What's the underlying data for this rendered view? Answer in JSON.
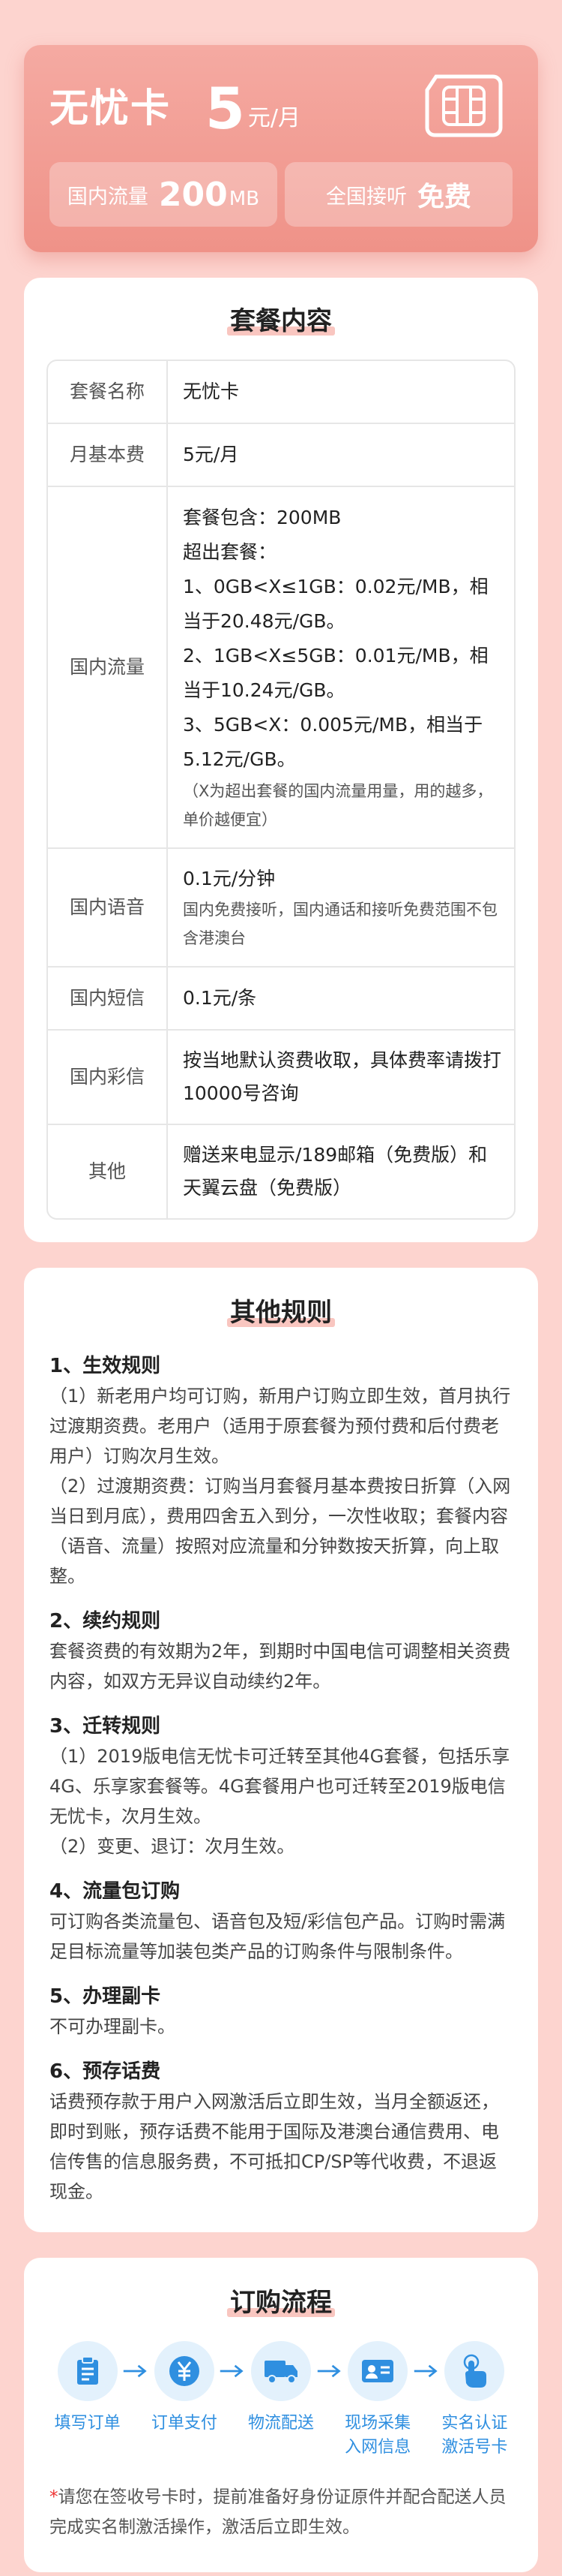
{
  "hero": {
    "name": "无忧卡",
    "price": "5",
    "price_unit": "元/月",
    "traffic_label": "国内流量",
    "traffic_value": "200",
    "traffic_unit": "MB",
    "call_label": "全国接听",
    "call_value": "免费"
  },
  "plan": {
    "title": "套餐内容",
    "rows": {
      "name": {
        "key": "套餐名称",
        "value": "无忧卡"
      },
      "fee": {
        "key": "月基本费",
        "value": "5元/月"
      },
      "traffic": {
        "key": "国内流量",
        "lines": [
          "套餐包含：200MB",
          "超出套餐：",
          "1、0GB<X≤1GB：0.02元/MB，相当于20.48元/GB。",
          "2、1GB<X≤5GB：0.01元/MB，相当于10.24元/GB。",
          "3、5GB<X：0.005元/MB，相当于5.12元/GB。"
        ],
        "note": "（X为超出套餐的国内流量用量，用的越多，单价越便宜）"
      },
      "voice": {
        "key": "国内语音",
        "value": "0.1元/分钟",
        "note": "国内免费接听，国内通话和接听免费范围不包含港澳台"
      },
      "sms": {
        "key": "国内短信",
        "value": "0.1元/条"
      },
      "mms": {
        "key": "国内彩信",
        "value": "按当地默认资费收取，具体费率请拨打10000号咨询"
      },
      "other": {
        "key": "其他",
        "value": "赠送来电显示/189邮箱（免费版）和天翼云盘（免费版）"
      }
    }
  },
  "rules": {
    "title": "其他规则",
    "r1": {
      "title": "1、生效规则",
      "p1": "（1）新老用户均可订购，新用户订购立即生效，首月执行过渡期资费。老用户（适用于原套餐为预付费和后付费老用户）订购次月生效。",
      "p2": "（2）过渡期资费：订购当月套餐月基本费按日折算（入网当日到月底），费用四舍五入到分，一次性收取；套餐内容（语音、流量）按照对应流量和分钟数按天折算，向上取整。"
    },
    "r2": {
      "title": "2、续约规则",
      "p1": "套餐资费的有效期为2年，到期时中国电信可调整相关资费内容，如双方无异议自动续约2年。"
    },
    "r3": {
      "title": "3、迁转规则",
      "p1": "（1）2019版电信无忧卡可迁转至其他4G套餐，包括乐享4G、乐享家套餐等。4G套餐用户也可迁转至2019版电信无忧卡，次月生效。",
      "p2": "（2）变更、退订：次月生效。"
    },
    "r4": {
      "title": "4、流量包订购",
      "p1": "可订购各类流量包、语音包及短/彩信包产品。订购时需满足目标流量等加装包类产品的订购条件与限制条件。"
    },
    "r5": {
      "title": "5、办理副卡",
      "p1": "不可办理副卡。"
    },
    "r6": {
      "title": "6、预存话费",
      "p1": "话费预存款于用户入网激活后立即生效，当月全额返还，即时到账，预存话费不能用于国际及港澳台通信费用、电信传售的信息服务费，不可抵扣CP/SP等代收费，不退返现金。"
    }
  },
  "process": {
    "title": "订购流程",
    "steps": [
      {
        "l1": "填写订单",
        "l2": ""
      },
      {
        "l1": "订单支付",
        "l2": ""
      },
      {
        "l1": "物流配送",
        "l2": ""
      },
      {
        "l1": "现场采集",
        "l2": "入网信息"
      },
      {
        "l1": "实名认证",
        "l2": "激活号卡"
      }
    ],
    "note_star": "*",
    "note": "请您在签收号卡时，提前准备好身份证原件并配合配送人员完成实名制激活操作，激活后立即生效。",
    "icon_color": "#2f8fe0"
  },
  "colors": {
    "page_bg": "#fdd4cf",
    "hero_bg": "#ef9288",
    "accent_blue": "#2f8fe0"
  },
  "icons": [
    "sim-card-icon",
    "clipboard-icon",
    "yuan-icon",
    "truck-icon",
    "id-card-icon",
    "hand-tap-icon",
    "arrow-right-icon"
  ]
}
